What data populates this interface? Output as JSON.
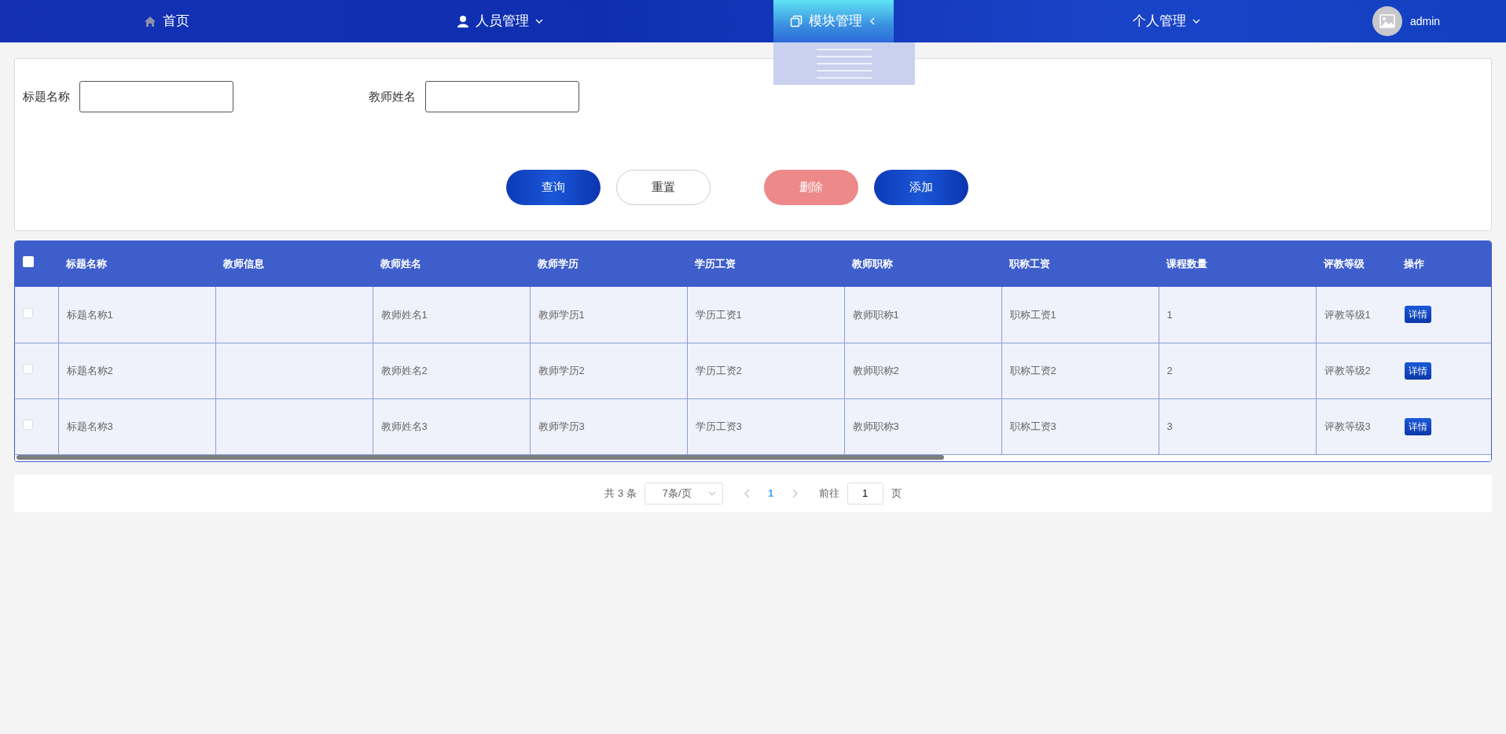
{
  "nav": {
    "items": [
      {
        "label": "首页",
        "kind": "link",
        "expanded": false
      },
      {
        "label": "人员管理",
        "kind": "menu",
        "expanded": false
      },
      {
        "label": "模块管理",
        "kind": "menu",
        "expanded": true
      },
      {
        "label": "个人管理",
        "kind": "menu",
        "expanded": false
      }
    ],
    "user": {
      "name": "admin"
    }
  },
  "search": {
    "fields": [
      {
        "label": "标题名称"
      },
      {
        "label": "教师姓名"
      }
    ],
    "buttons": [
      {
        "label": "查询",
        "kind": "primary",
        "disabled": false
      },
      {
        "label": "重置",
        "kind": "outline",
        "disabled": false
      },
      {
        "label": "删除",
        "kind": "danger",
        "disabled": true
      },
      {
        "label": "添加",
        "kind": "primary",
        "disabled": false
      }
    ]
  },
  "table": {
    "header_checked": false,
    "columns": [
      "标题名称",
      "教师信息",
      "教师姓名",
      "教师学历",
      "学历工资",
      "教师职称",
      "职称工资",
      "课程数量",
      "评教等级"
    ],
    "action_column": "操作",
    "rows": [
      {
        "checked": false,
        "cells": [
          "标题名称1",
          null,
          "教师姓名1",
          "教师学历1",
          "学历工资1",
          "教师职称1",
          "职称工资1",
          "1",
          "评教等级1"
        ],
        "action": "详情"
      },
      {
        "checked": false,
        "cells": [
          "标题名称2",
          null,
          "教师姓名2",
          "教师学历2",
          "学历工资2",
          "教师职称2",
          "职称工资2",
          "2",
          "评教等级2"
        ],
        "action": "详情"
      },
      {
        "checked": false,
        "cells": [
          "标题名称3",
          null,
          "教师姓名3",
          "教师学历3",
          "学历工资3",
          "教师职称3",
          "职称工资3",
          "3",
          "评教等级3"
        ],
        "action": "详情"
      }
    ]
  },
  "pagination": {
    "total": "共 3 条",
    "page_size": "7条/页",
    "pages": [
      {
        "label": "1",
        "selected": true
      }
    ],
    "goto_label": "前往",
    "goto_value": "1",
    "goto_suffix": "页"
  }
}
